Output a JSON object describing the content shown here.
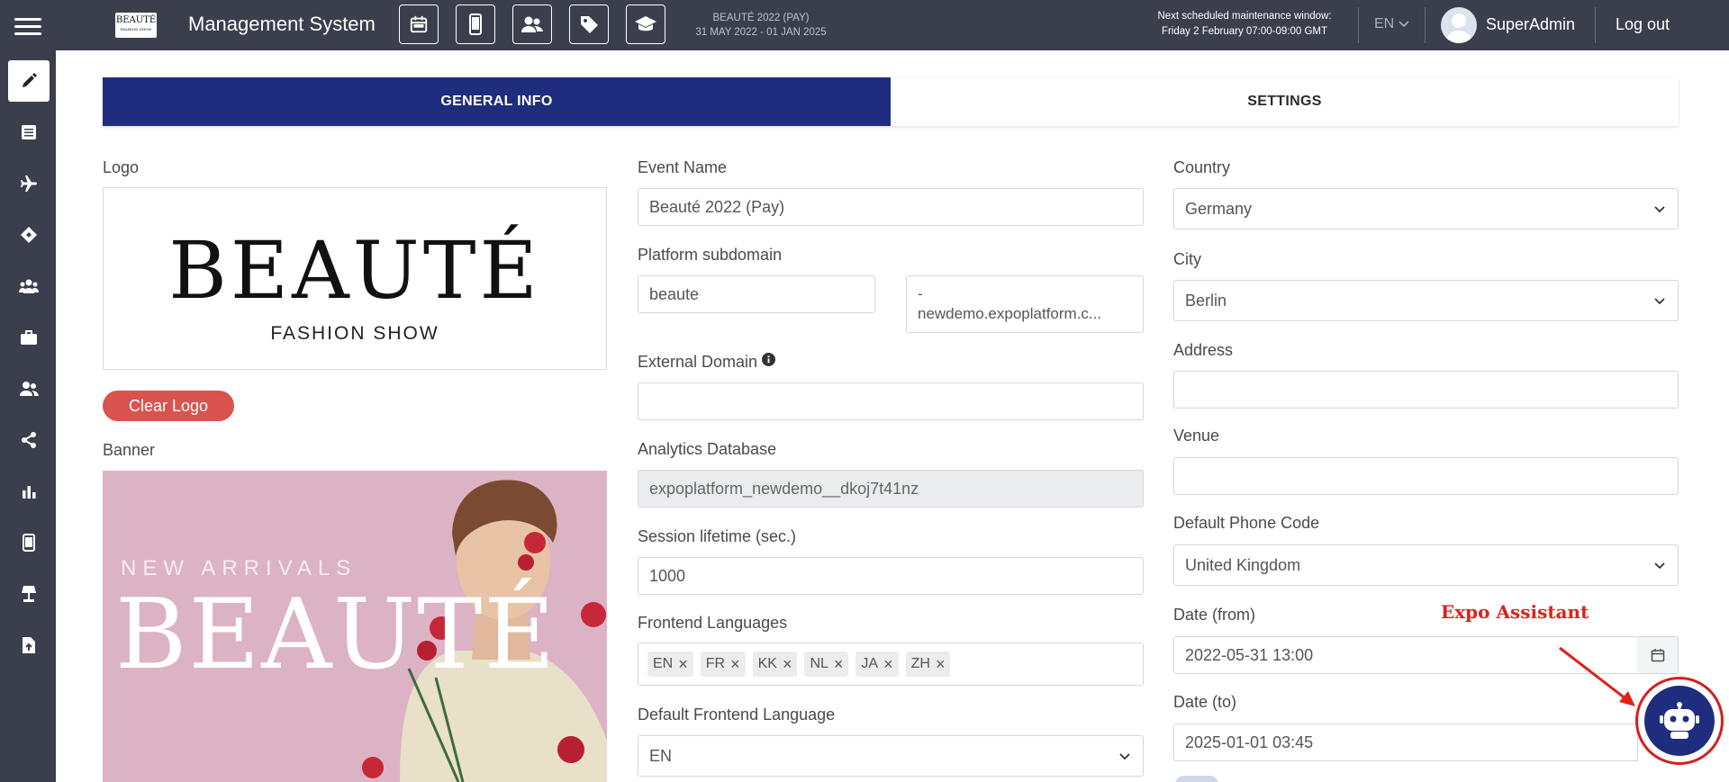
{
  "header": {
    "brand_logo_text": "BEAUTÉ",
    "app_title": "Management System",
    "event_name": "BEAUTÉ 2022 (PAY)",
    "event_dates": "31 MAY 2022 - 01 JAN 2025",
    "maintenance_line1": "Next scheduled maintenance window:",
    "maintenance_line2": "Friday 2 February 07:00-09:00 GMT",
    "language": "EN",
    "username": "SuperAdmin",
    "logout_label": "Log out",
    "toolbar_icons": [
      "calendar-icon",
      "mobile-icon",
      "users-icon",
      "tag-icon",
      "graduation-cap-icon"
    ]
  },
  "sidebar": {
    "items": [
      "pencil-icon",
      "list-icon",
      "plane-icon",
      "ticket-icon",
      "group-icon",
      "briefcase-icon",
      "users-icon",
      "share-icon",
      "bar-chart-icon",
      "mobile-icon",
      "lamp-icon",
      "file-upload-icon"
    ],
    "active_index": 0
  },
  "tabs": [
    {
      "label": "GENERAL INFO",
      "active": true
    },
    {
      "label": "SETTINGS",
      "active": false
    }
  ],
  "left": {
    "logo_label": "Logo",
    "logo_word": "BEAUTÉ",
    "logo_sub": "FASHION SHOW",
    "clear_logo_label": "Clear Logo",
    "banner_label": "Banner",
    "banner_top": "NEW ARRIVALS",
    "banner_word": "BEAUTÉ"
  },
  "middle": {
    "event_name_label": "Event Name",
    "event_name_value": "Beauté 2022 (Pay)",
    "subdomain_label": "Platform subdomain",
    "subdomain_value": "beaute",
    "subdomain_suffix_line1": "-",
    "subdomain_suffix_line2": "newdemo.expoplatform.c...",
    "external_domain_label": "External Domain",
    "external_domain_value": "",
    "analytics_label": "Analytics Database",
    "analytics_value": "expoplatform_newdemo__dkoj7t41nz",
    "session_label": "Session lifetime (sec.)",
    "session_value": "1000",
    "frontend_languages_label": "Frontend Languages",
    "frontend_languages": [
      "EN",
      "FR",
      "KK",
      "NL",
      "JA",
      "ZH"
    ],
    "default_language_label": "Default Frontend Language",
    "default_language_value": "EN"
  },
  "right": {
    "country_label": "Country",
    "country_value": "Germany",
    "city_label": "City",
    "city_value": "Berlin",
    "address_label": "Address",
    "address_value": "",
    "venue_label": "Venue",
    "venue_value": "",
    "phone_code_label": "Default Phone Code",
    "phone_code_value": "United Kingdom",
    "date_from_label": "Date (from)",
    "date_from_value": "2022-05-31 13:00",
    "date_to_label": "Date (to)",
    "date_to_value": "2025-01-01 03:45"
  },
  "assistant": {
    "label": "Expo Assistant"
  },
  "colors": {
    "topbar": "#3b3f4d",
    "tab_active": "#1f2d7e",
    "clear_button": "#d9534f",
    "annotation": "#e0201c"
  }
}
